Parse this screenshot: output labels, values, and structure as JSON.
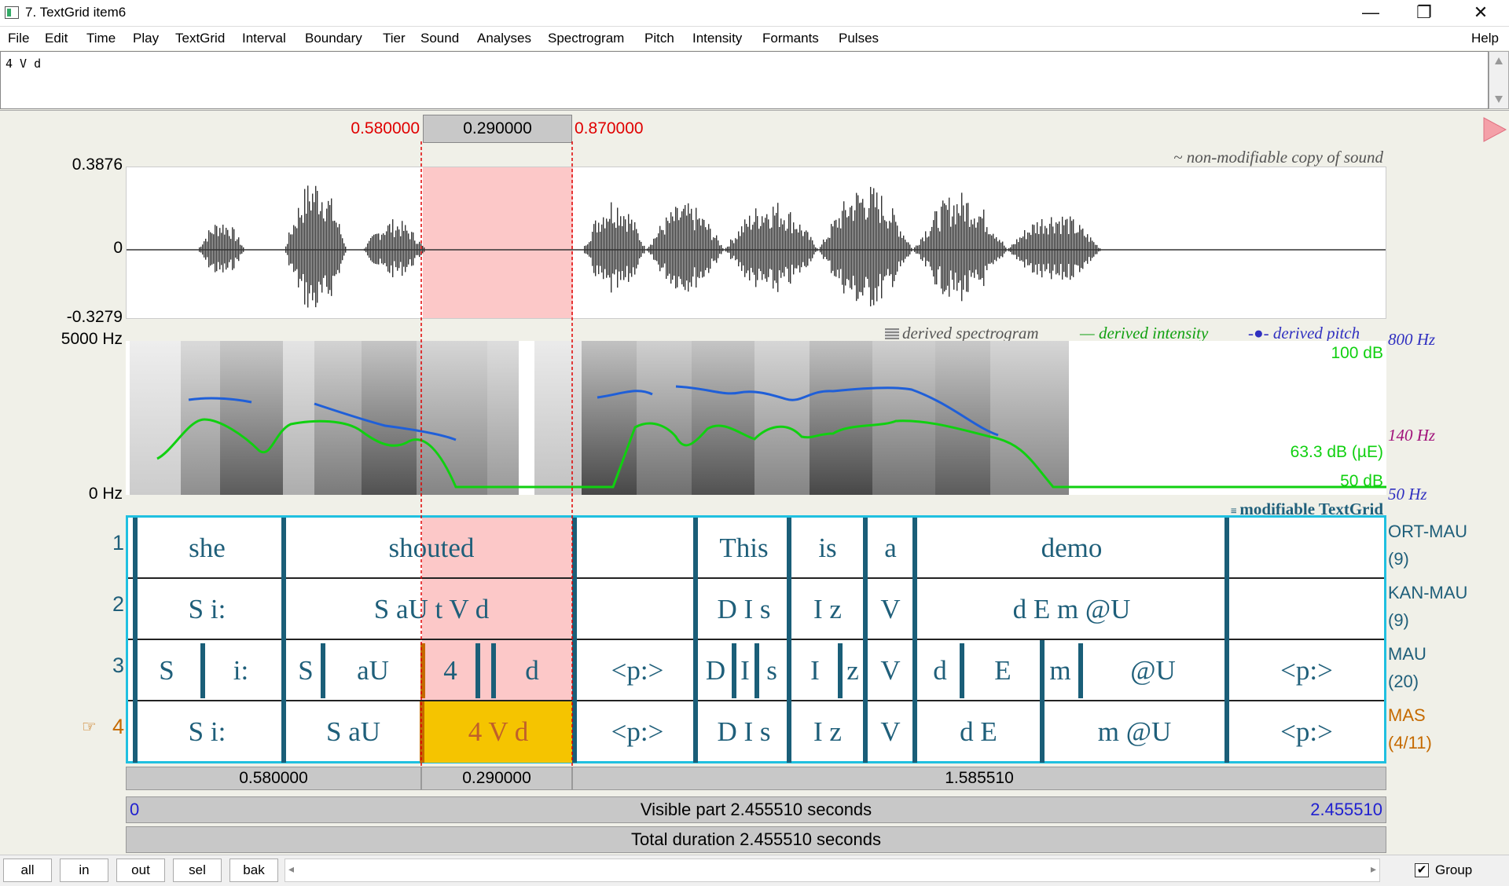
{
  "window": {
    "title": "7. TextGrid item6",
    "min": "—",
    "restore": "❐",
    "close": "✕"
  },
  "menu": [
    "File",
    "Edit",
    "Time",
    "Play",
    "TextGrid",
    "Interval",
    "Boundary",
    "Tier",
    "Sound",
    "Analyses",
    "Spectrogram",
    "Pitch",
    "Intensity",
    "Formants",
    "Pulses"
  ],
  "menu_help": "Help",
  "text_field": {
    "value": "4 V d"
  },
  "selection": {
    "start": "0.580000",
    "duration": "0.290000",
    "end": "0.870000"
  },
  "sound": {
    "ymax": "0.3876",
    "yzero": "0",
    "ymin": "-0.3279",
    "caption": "~ non-modifiable copy of sound"
  },
  "spectrogram": {
    "fmax": "5000 Hz",
    "fmin": "0 Hz",
    "legend_spec": "derived spectrogram",
    "legend_intensity": "derived intensity",
    "legend_pitch": "derived pitch",
    "pitch_max": "800 Hz",
    "pitch_mid": "140 Hz",
    "pitch_min": "50 Hz",
    "int_max": "100 dB",
    "int_cur": "63.3 dB (µE)",
    "int_min": "50 dB",
    "colors": {
      "pitch": "#1f5fd8",
      "intensity": "#10d010",
      "pitchlabel": "#3030c0",
      "intlabel": "#10d010",
      "midlabel": "#a0107a"
    }
  },
  "textgrid": {
    "caption": "modifiable TextGrid",
    "tiers": [
      {
        "num": "1",
        "name": "ORT-MAU",
        "count": "(9)",
        "segs": [
          "she",
          "shouted",
          "",
          "This",
          "is",
          "a",
          "demo",
          ""
        ]
      },
      {
        "num": "2",
        "name": "KAN-MAU",
        "count": "(9)",
        "segs": [
          "S i:",
          "S aU t V d",
          "",
          "D I s",
          "I z",
          "V",
          "d E m @U",
          ""
        ]
      },
      {
        "num": "3",
        "name": "MAU",
        "count": "(20)",
        "segs": [
          "S",
          "i:",
          "S",
          "aU",
          "4",
          "",
          "d",
          "<p:>",
          "D",
          "I",
          "s",
          "I",
          "z",
          "V",
          "d",
          "E",
          "m",
          "@U",
          "<p:>"
        ]
      },
      {
        "num": "4",
        "name": "MAS",
        "count": "(4/11)",
        "pointer": "☞",
        "segs": [
          "S i:",
          "S aU",
          "4 V d",
          "<p:>",
          "D I s",
          "I z",
          "V",
          "d E",
          "m @U",
          "<p:>"
        ]
      }
    ]
  },
  "durations": {
    "before": "0.580000",
    "selected": "0.290000",
    "after": "1.585510"
  },
  "visible": {
    "start": "0",
    "text": "Visible part 2.455510 seconds",
    "end": "2.455510"
  },
  "total": {
    "text": "Total duration 2.455510 seconds"
  },
  "bottom": {
    "buttons": [
      "all",
      "in",
      "out",
      "sel",
      "bak"
    ],
    "group_label": "Group",
    "group_checked": true
  }
}
